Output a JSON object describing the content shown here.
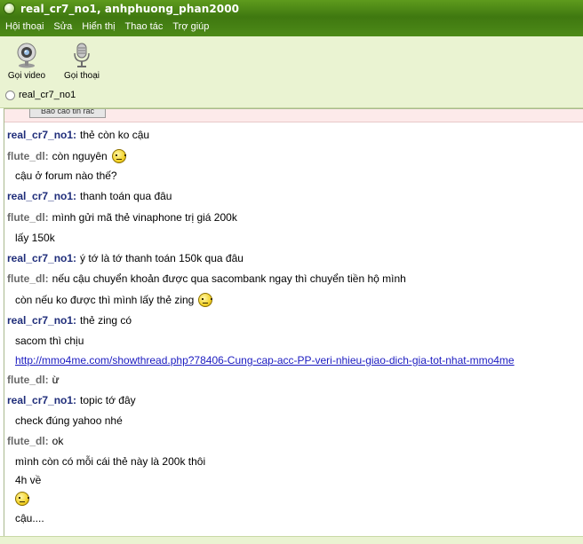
{
  "window": {
    "title": "real_cr7_no1, anhphuong_phan2000"
  },
  "menu": [
    "Hội thoại",
    "Sửa",
    "Hiển thị",
    "Thao tác",
    "Trợ giúp"
  ],
  "toolbar": {
    "video_label": "Gọi video",
    "voice_label": "Gọi thoại"
  },
  "contact": {
    "name": "real_cr7_no1"
  },
  "notice": {
    "button_label": "Báo cáo tin rác"
  },
  "colors": {
    "titlebar": "#3f7810",
    "toolbar_bg": "#eaf3d2",
    "nick_self": "#1f2d7a",
    "nick_other": "#6a6a6a",
    "link": "#1a1ac0"
  },
  "messages": [
    {
      "nick": "real_cr7_no1:",
      "text": "thẻ còn ko cậu"
    },
    {
      "nick": "flute_dl:",
      "text": "còn nguyên",
      "emoticon": "sad-face-icon"
    },
    {
      "text": "cậu ở forum nào thế?"
    },
    {
      "nick": "real_cr7_no1:",
      "text": "thanh toán qua đâu"
    },
    {
      "nick": "flute_dl:",
      "text": "mình gửi mã thẻ vinaphone trị giá 200k"
    },
    {
      "text": "lấy 150k"
    },
    {
      "nick": "real_cr7_no1:",
      "text": "ý tớ là tớ thanh toán 150k qua đâu"
    },
    {
      "nick": "flute_dl:",
      "text": "nếu cậu chuyển khoản được qua sacombank ngay thì chuyển tiền hộ mình"
    },
    {
      "text": "còn nếu ko được thì mình lấy thẻ zing",
      "emoticon": "sad-face-icon"
    },
    {
      "nick": "real_cr7_no1:",
      "text": "thẻ zing có"
    },
    {
      "text": "sacom thì chịu"
    },
    {
      "link": "http://mmo4me.com/showthread.php?78406-Cung-cap-acc-PP-veri-nhieu-giao-dich-gia-tot-nhat-mmo4me"
    },
    {
      "nick": "flute_dl:",
      "text": "ừ"
    },
    {
      "nick": "real_cr7_no1:",
      "text": "topic tớ đây"
    },
    {
      "text": "check đúng yahoo nhé"
    },
    {
      "nick": "flute_dl:",
      "text": "ok"
    },
    {
      "text": "mình còn có mỗi cái thẻ này là 200k thôi"
    },
    {
      "text": "4h về"
    },
    {
      "emoticon": "sad-face-icon"
    },
    {
      "text": "cậu...."
    }
  ]
}
